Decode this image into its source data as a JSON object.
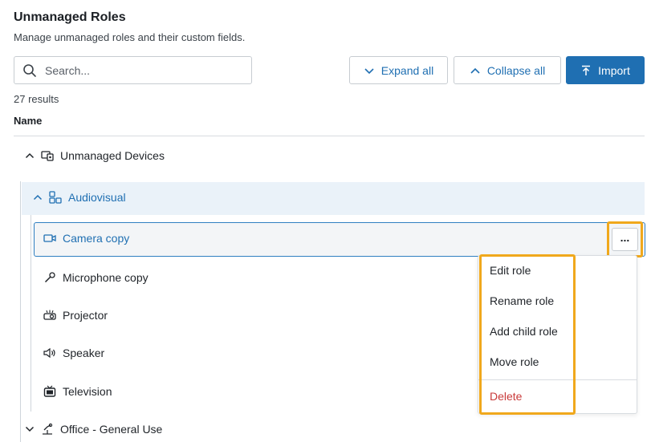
{
  "header": {
    "title": "Unmanaged Roles",
    "subtitle": "Manage unmanaged roles and their custom fields."
  },
  "search": {
    "placeholder": "Search..."
  },
  "toolbar": {
    "expand_label": "Expand all",
    "collapse_label": "Collapse all",
    "import_label": "Import"
  },
  "results": {
    "count_text": "27 results"
  },
  "table": {
    "column_name": "Name"
  },
  "tree": {
    "group": {
      "label": "Unmanaged Devices",
      "icon": "device-group-icon"
    },
    "category": {
      "label": "Audiovisual",
      "icon": "audiovisual-icon"
    },
    "items": [
      {
        "label": "Camera copy",
        "icon": "camera-icon",
        "selected": true
      },
      {
        "label": "Microphone copy",
        "icon": "microphone-icon"
      },
      {
        "label": "Projector",
        "icon": "projector-icon"
      },
      {
        "label": "Speaker",
        "icon": "speaker-icon"
      },
      {
        "label": "Television",
        "icon": "television-icon"
      }
    ],
    "next_group": {
      "label": "Office - General Use",
      "icon": "office-icon"
    }
  },
  "more_button": {
    "label": "..."
  },
  "context_menu": {
    "items": [
      "Edit role",
      "Rename role",
      "Add child role",
      "Move role"
    ],
    "delete_label": "Delete"
  },
  "colors": {
    "accent": "#1f6fb2",
    "highlight": "#f0a81c",
    "selected_bg": "#eaf2f9",
    "danger": "#c93a3a"
  }
}
